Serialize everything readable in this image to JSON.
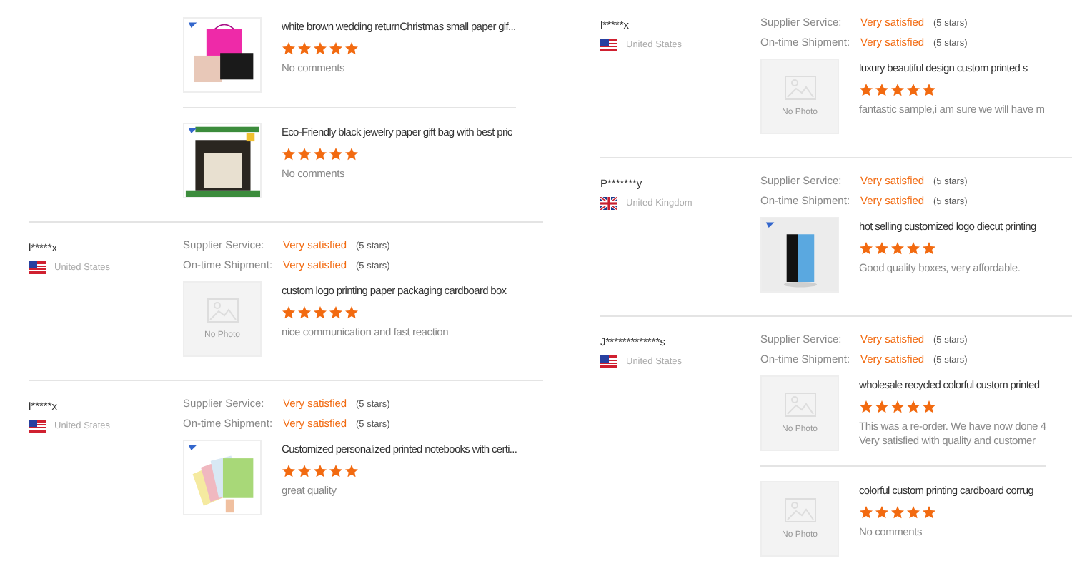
{
  "columns": [
    {
      "reviews": [
        {
          "items": [
            {
              "image": {
                "kind": "picture"
              },
              "title": "white brown wedding returnChristmas small paper gif...",
              "stars": 5,
              "comment": [
                "No comments"
              ]
            },
            {
              "image": {
                "kind": "picture"
              },
              "title": "Eco-Friendly black jewelry paper gift bag with best pric",
              "stars": 5,
              "comment": [
                "No comments"
              ]
            }
          ]
        },
        {
          "reviewer": {
            "name": "l*****x",
            "flag": {
              "kind": "us"
            },
            "country": "United States"
          },
          "ratings": [
            {
              "label": "Supplier Service:",
              "value": "Very satisfied",
              "note": "(5 stars)"
            },
            {
              "label": "On-time Shipment:",
              "value": "Very satisfied",
              "note": "(5 stars)"
            }
          ],
          "items": [
            {
              "image": {
                "kind": "placeholder",
                "label": "No Photo"
              },
              "title": "custom logo printing paper packaging cardboard box",
              "stars": 5,
              "comment": [
                "nice communication and fast reaction"
              ]
            }
          ]
        },
        {
          "reviewer": {
            "name": "l*****x",
            "flag": {
              "kind": "us"
            },
            "country": "United States"
          },
          "ratings": [
            {
              "label": "Supplier Service:",
              "value": "Very satisfied",
              "note": "(5 stars)"
            },
            {
              "label": "On-time Shipment:",
              "value": "Very satisfied",
              "note": "(5 stars)"
            }
          ],
          "items": [
            {
              "image": {
                "kind": "picture"
              },
              "title": "Customized personalized printed notebooks with certi...",
              "stars": 5,
              "comment": [
                "great quality"
              ]
            }
          ]
        }
      ]
    },
    {
      "reviews": [
        {
          "reviewer": {
            "name": "l*****x",
            "flag": {
              "kind": "us"
            },
            "country": "United States"
          },
          "ratings": [
            {
              "label": "Supplier Service:",
              "value": "Very satisfied",
              "note": "(5 stars)"
            },
            {
              "label": "On-time Shipment:",
              "value": "Very satisfied",
              "note": "(5 stars)"
            }
          ],
          "items": [
            {
              "image": {
                "kind": "placeholder",
                "label": "No Photo"
              },
              "title": "luxury beautiful design custom printed s",
              "stars": 5,
              "comment": [
                "fantastic sample,i am sure we will have m"
              ]
            }
          ]
        },
        {
          "reviewer": {
            "name": "P*******y",
            "flag": {
              "kind": "uk"
            },
            "country": "United Kingdom"
          },
          "ratings": [
            {
              "label": "Supplier Service:",
              "value": "Very satisfied",
              "note": "(5 stars)"
            },
            {
              "label": "On-time Shipment:",
              "value": "Very satisfied",
              "note": "(5 stars)"
            }
          ],
          "items": [
            {
              "image": {
                "kind": "picture"
              },
              "title": "hot selling customized logo diecut printing",
              "stars": 5,
              "comment": [
                "Good quality boxes, very affordable."
              ]
            }
          ]
        },
        {
          "reviewer": {
            "name": "J*************s",
            "flag": {
              "kind": "us"
            },
            "country": "United States"
          },
          "ratings": [
            {
              "label": "Supplier Service:",
              "value": "Very satisfied",
              "note": "(5 stars)"
            },
            {
              "label": "On-time Shipment:",
              "value": "Very satisfied",
              "note": "(5 stars)"
            }
          ],
          "items": [
            {
              "image": {
                "kind": "placeholder",
                "label": "No Photo"
              },
              "title": "wholesale recycled colorful custom printed",
              "stars": 5,
              "comment": [
                "This was a re-order. We have now done 4",
                "Very satisfied with quality and customer"
              ]
            },
            {
              "image": {
                "kind": "placeholder",
                "label": "No Photo"
              },
              "title": "colorful custom printing cardboard corrug",
              "stars": 5,
              "comment": [
                "No comments"
              ]
            }
          ]
        }
      ]
    }
  ]
}
